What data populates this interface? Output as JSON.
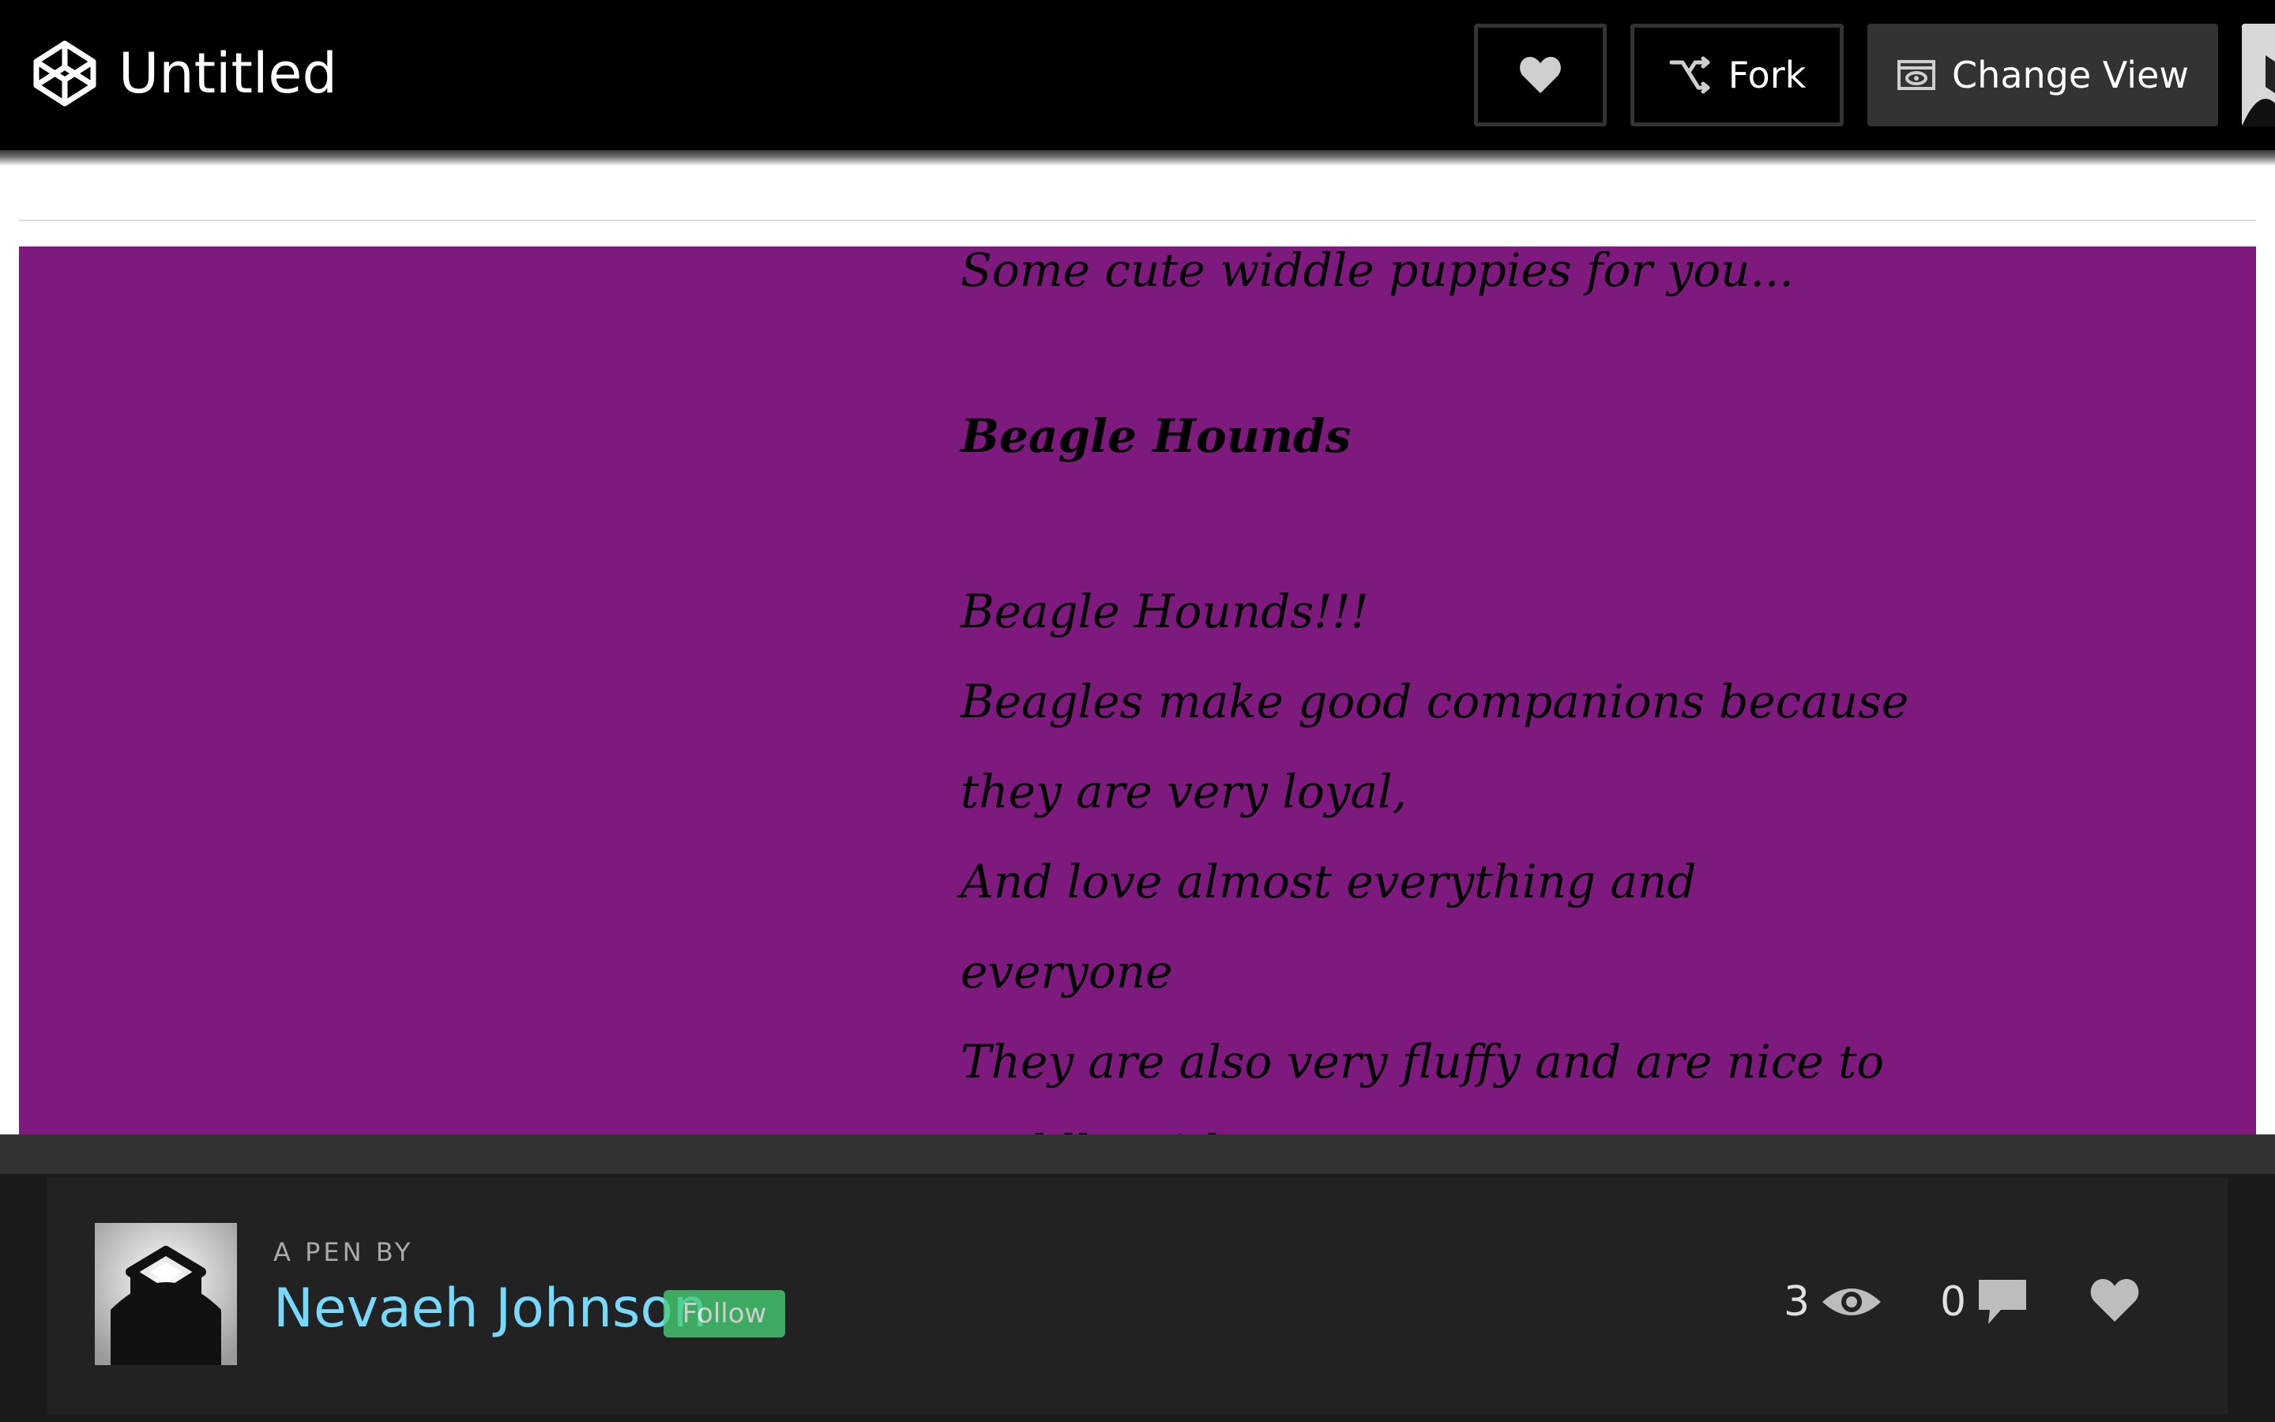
{
  "header": {
    "title": "Untitled",
    "fork_label": "Fork",
    "change_view_label": "Change View"
  },
  "preview": {
    "background_color": "#7e1a7e",
    "intro": "Some cute widdle puppies for you...",
    "heading": "Beagle Hounds",
    "body_lines": [
      "Beagle Hounds!!!",
      "Beagles make good companions because",
      "they are very loyal,",
      "And love almost everything and",
      "everyone",
      "They are also very fluffy and are nice to",
      "cuddle with."
    ]
  },
  "footer": {
    "pen_by_label": "A PEN BY",
    "author_name": "Nevaeh Johnson",
    "follow_label": "Follow",
    "views_count": "3",
    "comments_count": "0"
  },
  "colors": {
    "topbar": "#000000",
    "author_link": "#76daff",
    "follow": "#47cf73",
    "footer": "#222222"
  }
}
